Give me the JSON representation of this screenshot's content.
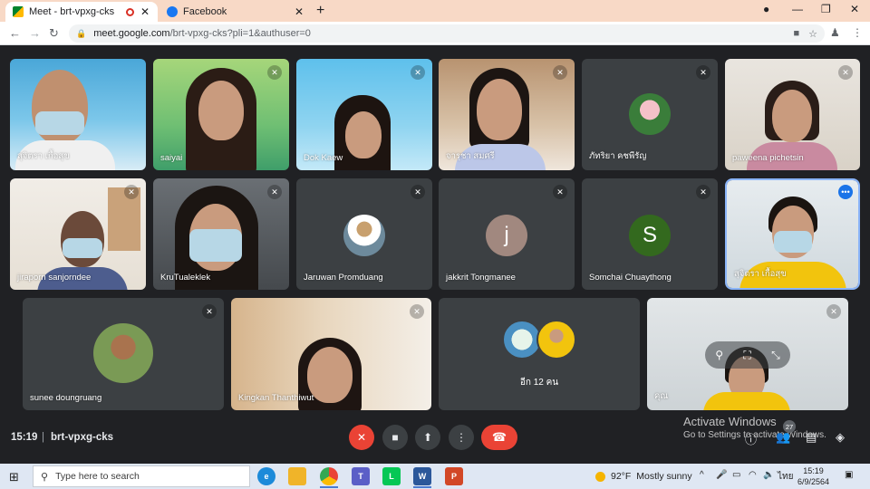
{
  "browser": {
    "tabs": [
      {
        "title": "Meet - brt-vpxg-cks",
        "active": true
      },
      {
        "title": "Facebook",
        "active": false
      }
    ],
    "url_host": "meet.google.com",
    "url_path": "/brt-vpxg-cks?pli=1&authuser=0"
  },
  "participants": [
    {
      "name": "สุจิตรา เกื้อสุข"
    },
    {
      "name": "saiyai"
    },
    {
      "name": "Dok Kaew"
    },
    {
      "name": "จารุชา สมศรี"
    },
    {
      "name": "ภัทริยา คชพีรัญ"
    },
    {
      "name": "paweena pichetsin"
    },
    {
      "name": "jiraporn sanjorndee"
    },
    {
      "name": "KruTualeklek"
    },
    {
      "name": "Jaruwan Promduang"
    },
    {
      "name": "jakkrit Tongmanee",
      "initial": "j"
    },
    {
      "name": "Somchai Chuaythong",
      "initial": "S"
    },
    {
      "name": "สุจิตรา เกื้อสุข"
    },
    {
      "name": "sunee doungruang"
    },
    {
      "name": "Kingkan Thanthiwut"
    },
    {
      "name": "อีก 12 คน"
    },
    {
      "name": "คุณ"
    }
  ],
  "bottom_bar": {
    "time": "15:19",
    "separator": "|",
    "meeting_code": "brt-vpxg-cks",
    "participant_count": "27"
  },
  "watermark": {
    "line1": "Activate Windows",
    "line2": "Go to Settings to activate Windows."
  },
  "taskbar": {
    "search_placeholder": "Type here to search",
    "temperature": "92°F",
    "weather": "Mostly sunny",
    "language": "ไทย",
    "time": "15:19",
    "date": "6/9/2564"
  },
  "colors": {
    "tab_strip": "#f8d9c6",
    "meet_background": "#202124",
    "tile_background": "#3c4043",
    "hangup_red": "#ea4335",
    "active_speaker_outline": "#8ab4f8",
    "avatar_jakkrit": "#a1887f",
    "avatar_somchai": "#33691e"
  }
}
